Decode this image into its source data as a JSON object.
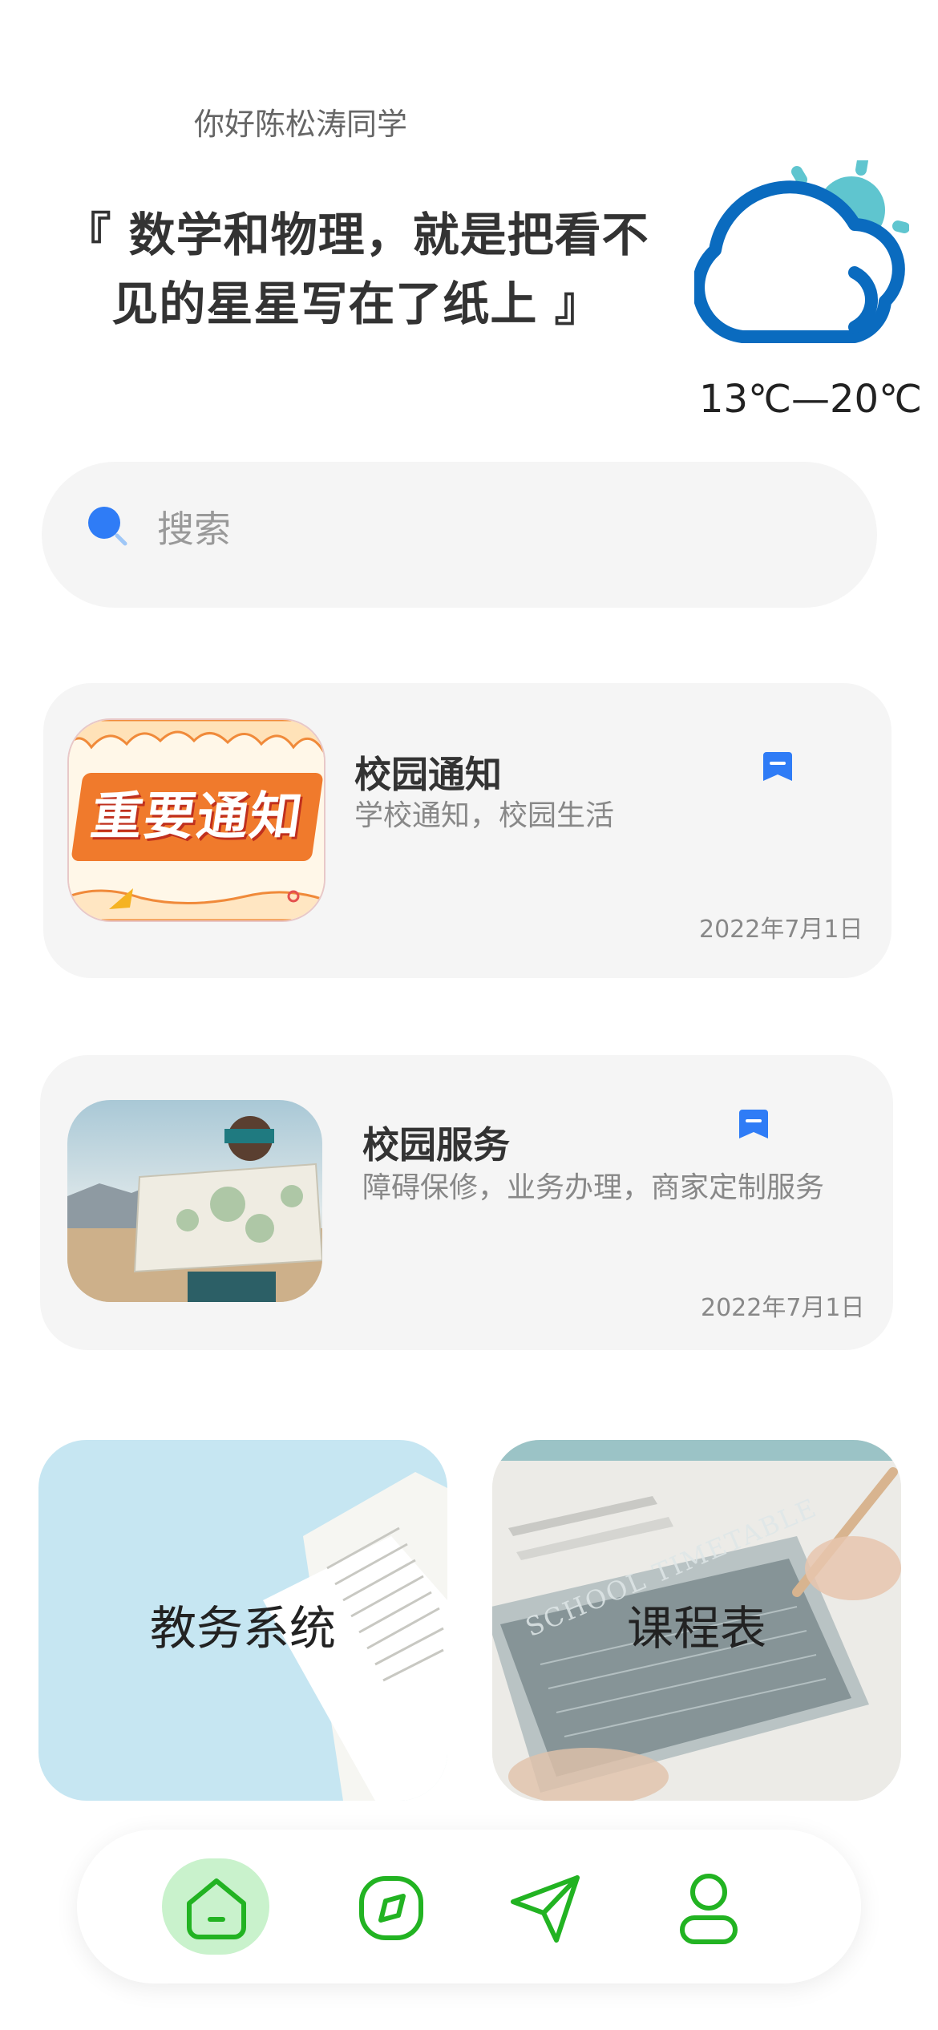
{
  "header": {
    "greeting": "你好陈松涛同学",
    "quote": "『 数学和物理，就是把看不见的星星写在了纸上 』"
  },
  "weather": {
    "icon": "partly-cloudy-icon",
    "temperature": "13℃—20℃"
  },
  "search": {
    "placeholder": "搜索"
  },
  "cards": [
    {
      "title": "校园通知",
      "subtitle": "学校通知，校园生活",
      "date": "2022年7月1日",
      "image_text": "重要通知"
    },
    {
      "title": "校园服务",
      "subtitle": "障碍保修，业务办理，商家定制服务",
      "date": "2022年7月1日"
    }
  ],
  "tiles": [
    {
      "label": "教务系统"
    },
    {
      "label": "课程表",
      "image_text": "SCHOOL TIMETABLE"
    }
  ],
  "nav": {
    "items": [
      "home-icon",
      "compass-icon",
      "send-icon",
      "profile-icon"
    ],
    "active": "home-icon"
  },
  "colors": {
    "accent_blue": "#2f7cf6",
    "nav_green": "#22b322",
    "nav_active_bg": "#c9f2cc",
    "weather_blue": "#0a6bbf",
    "weather_sun": "#5fc5cf"
  }
}
